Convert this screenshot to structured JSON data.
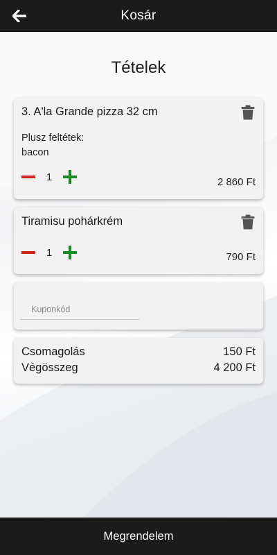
{
  "header": {
    "title": "Kosár",
    "back_icon": "arrow-left-icon"
  },
  "page_title": "Tételek",
  "items": [
    {
      "name": "3. A'la Grande pizza 32 cm",
      "extras_label": "Plusz feltétek:",
      "extras_value": "bacon",
      "quantity": "1",
      "price": "2 860 Ft"
    },
    {
      "name": "Tiramisu pohárkrém",
      "quantity": "1",
      "price": "790 Ft"
    }
  ],
  "coupon": {
    "placeholder": "Kuponkód",
    "value": ""
  },
  "summary": {
    "packaging_label": "Csomagolás",
    "packaging_value": "150 Ft",
    "total_label": "Végösszeg",
    "total_value": "4 200 Ft"
  },
  "footer": {
    "order_label": "Megrendelem"
  },
  "colors": {
    "bar_background": "#1b1b1b",
    "minus_color": "#d61f1f",
    "plus_color": "#1a8a22",
    "trash_color": "#555555",
    "card_background": "#f2f2f2"
  },
  "icons": [
    "arrow-left-icon",
    "trash-icon",
    "minus-icon",
    "plus-icon"
  ]
}
